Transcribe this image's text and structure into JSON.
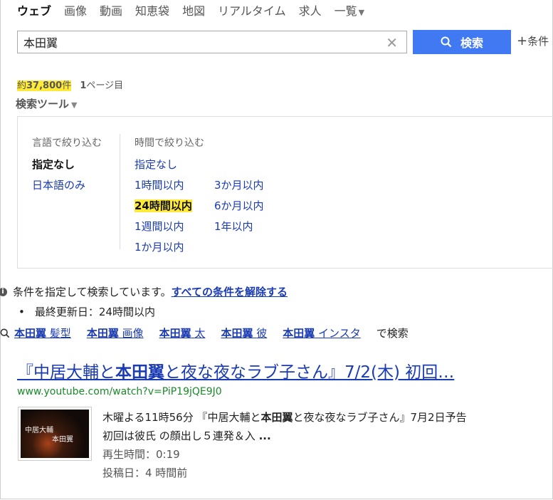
{
  "nav": {
    "items": [
      "ウェブ",
      "画像",
      "動画",
      "知恵袋",
      "地図",
      "リアルタイム",
      "求人"
    ],
    "more": "一覧",
    "active_index": 0
  },
  "search": {
    "query": "本田翼",
    "button_label": "検索",
    "conditions_label": "条件"
  },
  "results_count": {
    "prefix": "約",
    "number": "37,800",
    "suffix": "件",
    "page": "1",
    "page_suffix": "ページ目"
  },
  "tools": {
    "label": "検索ツール"
  },
  "filters": {
    "language": {
      "heading": "言語で絞り込む",
      "options": [
        "指定なし",
        "日本語のみ"
      ],
      "selected_index": 0
    },
    "time": {
      "heading": "時間で絞り込む",
      "options": [
        "指定なし",
        "1時間以内",
        "3か月以内",
        "24時間以内",
        "6か月以内",
        "1週間以内",
        "1年以内",
        "1か月以内"
      ],
      "selected": "24時間以内"
    }
  },
  "notice": {
    "text": "条件を指定して検索しています。",
    "clear_link": "すべての条件を解除する",
    "applied": "最終更新日：24時間以内"
  },
  "related": {
    "items": [
      {
        "main": "本田翼",
        "extra": "髪型"
      },
      {
        "main": "本田翼",
        "extra": "画像"
      },
      {
        "main": "本田翼",
        "extra": "太"
      },
      {
        "main": "本田翼",
        "extra": "彼"
      },
      {
        "main": "本田翼",
        "extra": "インスタ"
      }
    ],
    "tail": "で検索"
  },
  "result": {
    "title_pre": "『中居大輔と",
    "title_bold": "本田翼",
    "title_post": "と夜な夜なラブ子さん』7/2(木) 初回…",
    "url": "www.youtube.com/watch?v=PiP19jQE9J0",
    "thumb_text1": "中居大輔",
    "thumb_text2": "本田翼",
    "desc_pre": "木曜よる11時56分 『中居大輔と",
    "desc_bold": "本田翼",
    "desc_post": "と夜な夜なラブ子さん』7月2日予告",
    "desc_line2": "初回は彼氏 の顔出し５連発＆入",
    "desc_ellipsis": "...",
    "duration": "再生時間：0:19",
    "posted": "投稿日：4 時間前"
  }
}
